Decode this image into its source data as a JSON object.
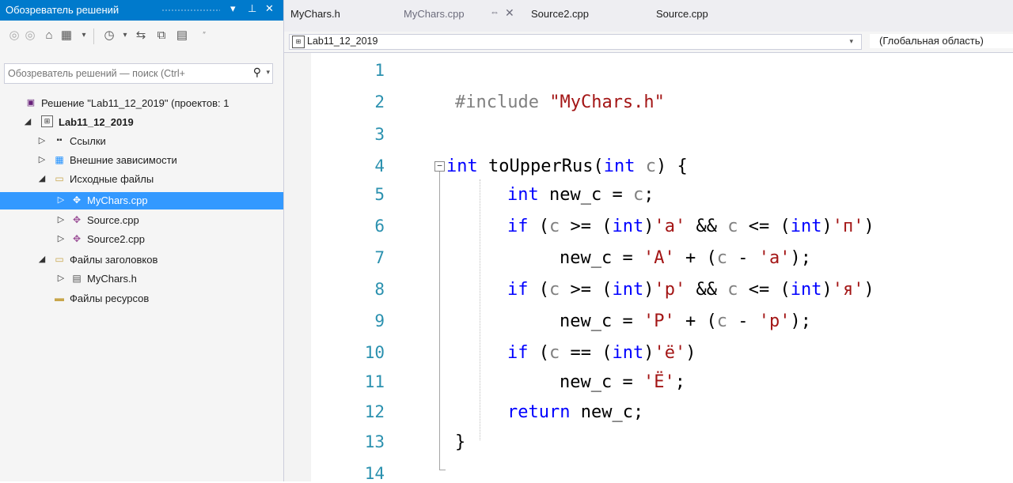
{
  "solution_explorer": {
    "title": "Обозреватель решений",
    "pin_icon": "pin-icon",
    "search_placeholder": "Обозреватель решений — поиск (Ctrl+",
    "tree": [
      {
        "label": "Решение \"Lab11_12_2019\"  (проектов: 1",
        "icon": "solution-icon"
      },
      {
        "label": "Lab11_12_2019",
        "icon": "project-icon",
        "bold": true
      },
      {
        "label": "Ссылки",
        "icon": "references-icon"
      },
      {
        "label": "Внешние зависимости",
        "icon": "external-deps-icon"
      },
      {
        "label": "Исходные файлы",
        "icon": "folder-icon"
      },
      {
        "label": "MyChars.cpp",
        "icon": "cpp-file-icon",
        "selected": true
      },
      {
        "label": "Source.cpp",
        "icon": "cpp-file-icon"
      },
      {
        "label": "Source2.cpp",
        "icon": "cpp-file-icon"
      },
      {
        "label": "Файлы заголовков",
        "icon": "folder-icon"
      },
      {
        "label": "MyChars.h",
        "icon": "header-file-icon"
      },
      {
        "label": "Файлы ресурсов",
        "icon": "folder-icon"
      }
    ]
  },
  "tabs": [
    {
      "label": "MyChars.h"
    },
    {
      "label": "MyChars.cpp",
      "active": true
    },
    {
      "label": "Source2.cpp"
    },
    {
      "label": "Source.cpp"
    }
  ],
  "navbar": {
    "project": "Lab11_12_2019",
    "scope": "(Глобальная область)"
  },
  "editor": {
    "line_numbers": [
      "1",
      "2",
      "3",
      "4",
      "5",
      "6",
      "7",
      "8",
      "9",
      "10",
      "11",
      "12",
      "13",
      "14"
    ],
    "code": {
      "l2_directive": "#include ",
      "l2_file": "\"MyChars.h\"",
      "kw_int": "int",
      "fn_name": "toUpperRus",
      "param": "c",
      "var": "new_c",
      "kw_if": "if",
      "kw_return": "return",
      "ch_a": "'a'",
      "ch_p_cyr": "'п'",
      "ch_A": "'A'",
      "ch_r": "'p'",
      "ch_ya": "'я'",
      "ch_R": "'P'",
      "ch_yo": "'ё'",
      "ch_YO": "'Ё'"
    }
  }
}
